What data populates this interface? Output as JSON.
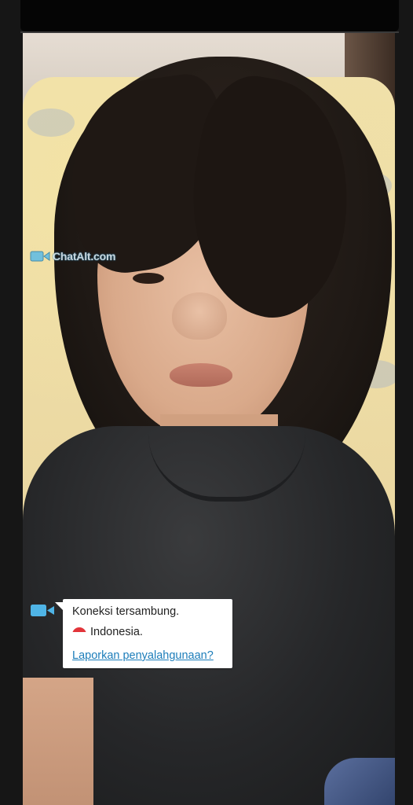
{
  "watermark": {
    "text": "ChatAlt.com",
    "icon": "video-camera-icon"
  },
  "chat": {
    "icon": "video-camera-icon",
    "status_text": "Koneksi tersambung.",
    "country_flag": "indonesia-flag-icon",
    "country_text": "Indonesia.",
    "report_link": "Laporkan penyalahgunaan?"
  },
  "colors": {
    "accent_blue": "#1c7dba",
    "camera_icon_blue": "#4fb4e6",
    "flag_red": "#e2343a"
  }
}
